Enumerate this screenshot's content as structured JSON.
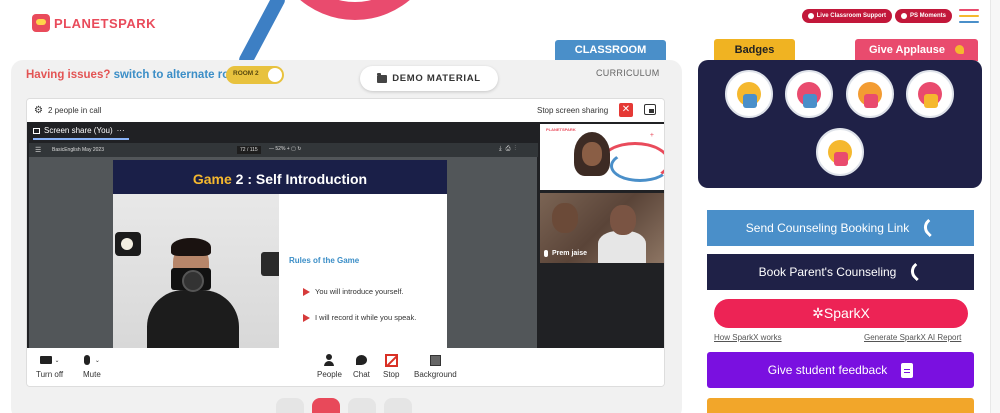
{
  "header": {
    "logo_text": "PLANETSPARK",
    "live_support": "Live Classroom Support",
    "ps_moments": "PS Moments"
  },
  "tabs": {
    "classroom": "CLASSROOM",
    "curriculum": "CURRICULUM"
  },
  "issues": {
    "prefix": "Having issues?",
    "link": "switch to alternate room",
    "room_label": "ROOM 2"
  },
  "demo_material": "DEMO MATERIAL",
  "call": {
    "people_count": "2 people in call",
    "stop_sharing": "Stop screen sharing",
    "screen_share_tab": "Screen share (You)",
    "pdf_name": "BasicEnglish May 2023",
    "pdf_page": "72 / 115",
    "pdf_zoom": "52%"
  },
  "slide": {
    "title_highlight": "Game",
    "title_rest": " 2 : Self Introduction",
    "rules_title": "Rules of the Game",
    "rules": [
      "You will introduce yourself.",
      "I will record it while you speak."
    ]
  },
  "participants": [
    {
      "name": "Khadija (You)"
    },
    {
      "name": "Prem jaise"
    }
  ],
  "tile_brand": "PLANETSPARK",
  "controls": {
    "turn_off": "Turn off",
    "mute": "Mute",
    "people": "People",
    "chat": "Chat",
    "stop": "Stop",
    "background": "Background"
  },
  "right": {
    "badges_tab": "Badges",
    "applause_tab": "Give Applause",
    "send_counseling": "Send Counseling Booking Link",
    "book_parent": "Book Parent's Counseling",
    "sparkx": "SparkX",
    "sparkx_how": "How SparkX works",
    "sparkx_generate": "Generate SparkX AI Report",
    "feedback": "Give student feedback"
  },
  "colors": {
    "brand_red": "#e94b5b",
    "classroom_blue": "#4a8fc9",
    "navy": "#1f2147",
    "sparkx_pink": "#ed2355",
    "feedback_purple": "#7a10e0",
    "badges_yellow": "#f0b322"
  }
}
